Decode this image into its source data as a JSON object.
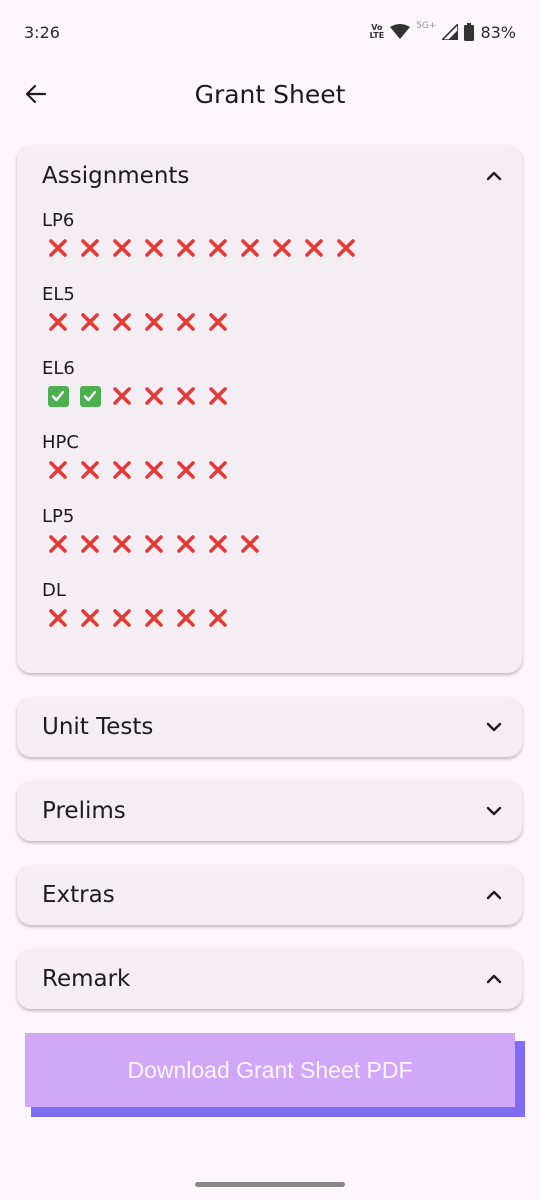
{
  "status_bar": {
    "time": "3:26",
    "volte_top": "Vo",
    "volte_bottom": "LTE",
    "network": "5G+",
    "battery": "83%"
  },
  "app_bar": {
    "title": "Grant Sheet",
    "back_icon": "arrow-left-icon"
  },
  "assignments": {
    "title": "Assignments",
    "expanded": true,
    "subjects": [
      {
        "name": "LP6",
        "marks": [
          "x",
          "x",
          "x",
          "x",
          "x",
          "x",
          "x",
          "x",
          "x",
          "x"
        ]
      },
      {
        "name": "EL5",
        "marks": [
          "x",
          "x",
          "x",
          "x",
          "x",
          "x"
        ]
      },
      {
        "name": "EL6",
        "marks": [
          "check",
          "check",
          "x",
          "x",
          "x",
          "x"
        ]
      },
      {
        "name": "HPC",
        "marks": [
          "x",
          "x",
          "x",
          "x",
          "x",
          "x"
        ]
      },
      {
        "name": "LP5",
        "marks": [
          "x",
          "x",
          "x",
          "x",
          "x",
          "x",
          "x"
        ]
      },
      {
        "name": "DL",
        "marks": [
          "x",
          "x",
          "x",
          "x",
          "x",
          "x"
        ]
      }
    ]
  },
  "sections": [
    {
      "title": "Unit Tests",
      "chevron": "down"
    },
    {
      "title": "Prelims",
      "chevron": "down"
    },
    {
      "title": "Extras",
      "chevron": "up"
    },
    {
      "title": "Remark",
      "chevron": "up"
    }
  ],
  "download_button": {
    "label": "Download Grant Sheet PDF"
  },
  "colors": {
    "background": "#fcf5fc",
    "card": "#f4eef4",
    "cross": "#e53935",
    "check": "#4caf50",
    "button": "#d1a8f7",
    "button_shadow": "#7e6cf2"
  }
}
